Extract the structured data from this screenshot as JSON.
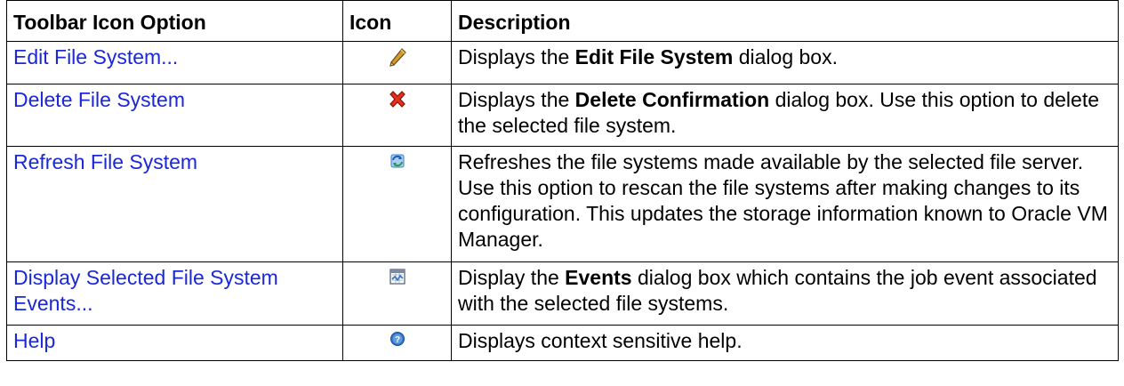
{
  "table": {
    "headers": {
      "option": "Toolbar Icon Option",
      "icon": "Icon",
      "description": "Description"
    },
    "rows": [
      {
        "option": "Edit File System...",
        "icon": "pencil-icon",
        "desc_pre": "Displays the ",
        "desc_bold": "Edit File System",
        "desc_post": " dialog box."
      },
      {
        "option": "Delete File System",
        "icon": "delete-x-icon",
        "desc_pre": "Displays the ",
        "desc_bold": "Delete Confirmation",
        "desc_post": " dialog box. Use this option to delete the selected file system."
      },
      {
        "option": "Refresh File System",
        "icon": "refresh-icon",
        "desc_pre": "Refreshes the file systems made available by the selected file server. Use this option to rescan the file systems after making changes to its configuration. This updates the storage information known to Oracle VM Manager.",
        "desc_bold": "",
        "desc_post": ""
      },
      {
        "option": "Display Selected File System Events...",
        "icon": "events-icon",
        "desc_pre": "Display the ",
        "desc_bold": "Events",
        "desc_post": " dialog box which contains the job event associated with the selected file systems."
      },
      {
        "option": "Help",
        "icon": "help-icon",
        "desc_pre": "Displays context sensitive help.",
        "desc_bold": "",
        "desc_post": ""
      }
    ]
  },
  "colors": {
    "link": "#1a28d6",
    "border": "#000000",
    "delete_icon": "#e0301e",
    "pencil_icon": "#d69a2a",
    "refresh_icon": "#3b7fd4",
    "help_icon": "#2f74c9"
  }
}
